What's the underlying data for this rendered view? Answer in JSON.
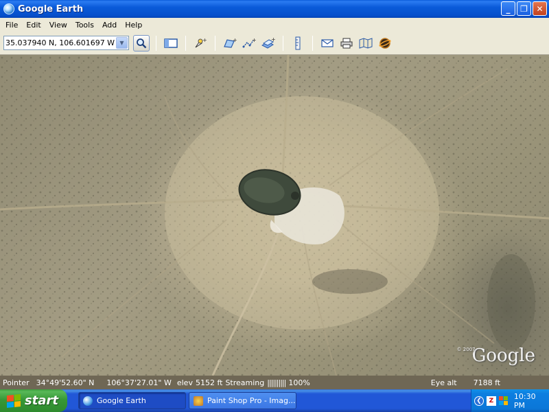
{
  "window": {
    "title": "Google Earth",
    "icon": "google-earth-globe-icon"
  },
  "menu": {
    "items": [
      "File",
      "Edit",
      "View",
      "Tools",
      "Add",
      "Help"
    ]
  },
  "toolbar": {
    "search_value": "35.037940 N, 106.601697 W",
    "buttons": [
      "sidebar-toggle-icon",
      "placemark-icon",
      "polygon-icon",
      "path-icon",
      "image-overlay-icon",
      "ruler-icon",
      "email-icon",
      "print-icon",
      "maps-icon",
      "sky-icon"
    ]
  },
  "map": {
    "watermark": "Google",
    "watermark_copyright": "© 2007"
  },
  "status": {
    "pointer_label": "Pointer",
    "pointer_lat": "34°49'52.60\" N",
    "pointer_lon": "106°37'27.01\" W",
    "elev_label": "elev",
    "elev_value": "5152 ft",
    "streaming_label": "Streaming",
    "streaming_bar": "||||||||||",
    "streaming_percent": "100%",
    "eye_alt_label": "Eye alt",
    "eye_alt_value": "7188 ft"
  },
  "taskbar": {
    "start_label": "start",
    "tasks": [
      {
        "label": "Google Earth",
        "icon": "google-earth-icon"
      },
      {
        "label": "Paint Shop Pro - Imag...",
        "icon": "paint-shop-pro-icon"
      }
    ],
    "clock": "10:30 PM"
  },
  "colors": {
    "titlebar": "#0a5bd9",
    "chrome": "#ece9d8",
    "taskbar": "#2157d7",
    "start": "#379837"
  }
}
